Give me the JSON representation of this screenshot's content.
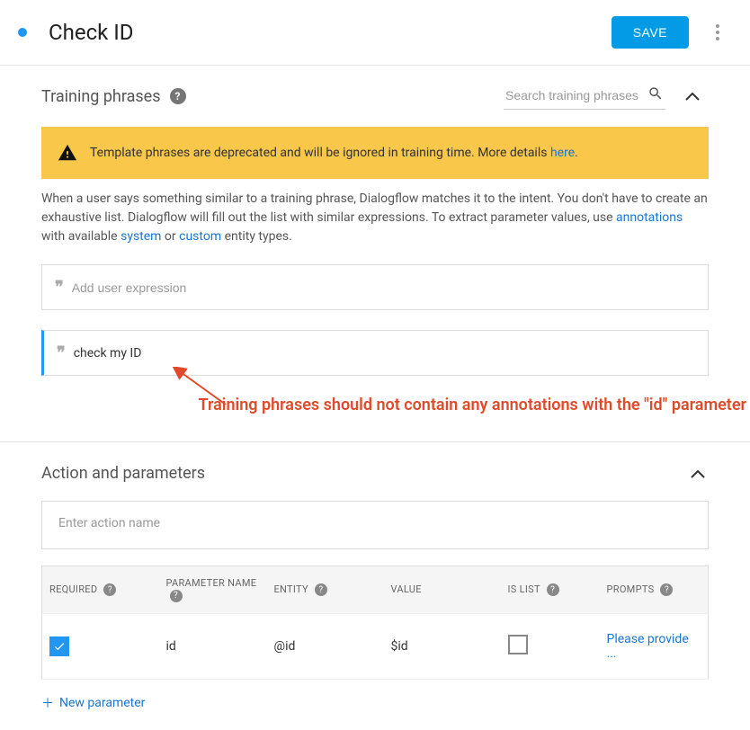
{
  "header": {
    "title": "Check ID",
    "save_label": "SAVE"
  },
  "training": {
    "section_title": "Training phrases",
    "search_placeholder": "Search training phrases",
    "warning_text": "Template phrases are deprecated and will be ignored in training time. More details ",
    "warning_link": "here",
    "warning_suffix": ".",
    "help_text_1": "When a user says something similar to a training phrase, Dialogflow matches it to the intent. You don't have to create an exhaustive list. Dialogflow will fill out the list with similar expressions. To extract parameter values, use ",
    "help_link_1": "annotations",
    "help_text_2": " with available ",
    "help_link_2": "system",
    "help_text_3": " or ",
    "help_link_3": "custom",
    "help_text_4": " entity types.",
    "add_placeholder": "Add user expression",
    "phrase_1": "check my ID",
    "annotation": "Training phrases should not contain any annotations with the \"id\" parameter"
  },
  "action": {
    "section_title": "Action and parameters",
    "action_placeholder": "Enter action name",
    "columns": {
      "required": "REQUIRED",
      "name": "PARAMETER NAME",
      "entity": "ENTITY",
      "value": "VALUE",
      "islist": "IS LIST",
      "prompts": "PROMPTS"
    },
    "rows": [
      {
        "required": true,
        "name": "id",
        "entity": "@id",
        "value": "$id",
        "islist": false,
        "prompt": "Please provide ..."
      }
    ],
    "new_param": "New parameter"
  }
}
